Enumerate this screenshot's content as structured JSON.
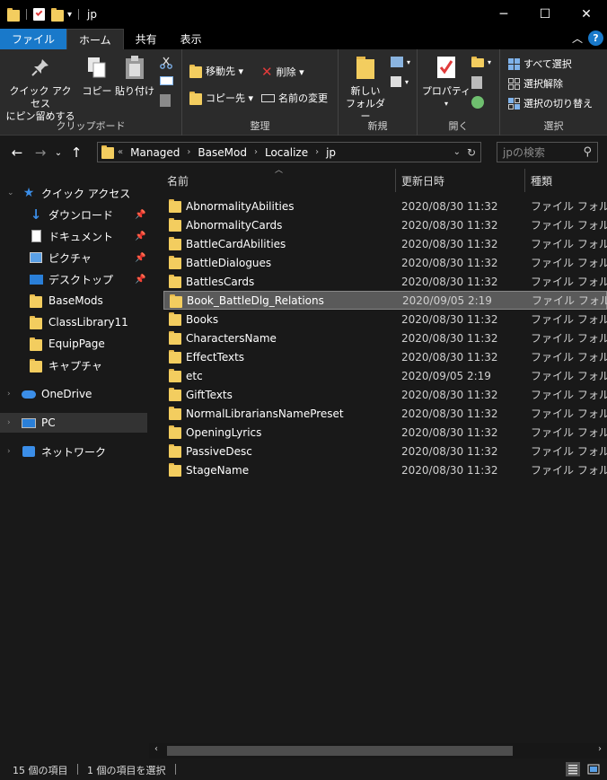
{
  "window": {
    "title": "jp",
    "quick_access_dropdown": "▾",
    "minimize": "─",
    "maximize": "☐",
    "close": "✕"
  },
  "ribbon_tabs": [
    {
      "label": "ファイル"
    },
    {
      "label": "ホーム"
    },
    {
      "label": "共有"
    },
    {
      "label": "表示"
    }
  ],
  "ribbon": {
    "clipboard": {
      "group_label": "クリップボード",
      "pin_quick_access_line1": "クイック アクセス",
      "pin_quick_access_line2": "にピン留めする",
      "copy": "コピー",
      "paste": "貼り付け"
    },
    "organize": {
      "group_label": "整理",
      "move_to": "移動先 ▾",
      "copy_to": "コピー先 ▾",
      "delete": "削除 ▾",
      "rename": "名前の変更"
    },
    "new": {
      "group_label": "新規",
      "new_folder_line1": "新しい",
      "new_folder_line2": "フォルダー"
    },
    "open": {
      "group_label": "開く",
      "properties": "プロパティ"
    },
    "select": {
      "group_label": "選択",
      "select_all": "すべて選択",
      "select_none": "選択解除",
      "invert_selection": "選択の切り替え"
    }
  },
  "address": {
    "overflow": "«",
    "crumbs": [
      "Managed",
      "BaseMod",
      "Localize",
      "jp"
    ],
    "search_placeholder": "jpの検索"
  },
  "navpane": {
    "quick_access": "クイック アクセス",
    "items": [
      {
        "label": "ダウンロード"
      },
      {
        "label": "ドキュメント"
      },
      {
        "label": "ピクチャ"
      },
      {
        "label": "デスクトップ"
      },
      {
        "label": "BaseMods"
      },
      {
        "label": "ClassLibrary11"
      },
      {
        "label": "EquipPage"
      },
      {
        "label": "キャプチャ"
      }
    ],
    "onedrive": "OneDrive",
    "pc": "PC",
    "network": "ネットワーク"
  },
  "columns": {
    "name": "名前",
    "date": "更新日時",
    "type": "種類"
  },
  "files": [
    {
      "name": "AbnormalityAbilities",
      "date": "2020/08/30 11:32",
      "type": "ファイル フォルダー"
    },
    {
      "name": "AbnormalityCards",
      "date": "2020/08/30 11:32",
      "type": "ファイル フォルダー"
    },
    {
      "name": "BattleCardAbilities",
      "date": "2020/08/30 11:32",
      "type": "ファイル フォルダー"
    },
    {
      "name": "BattleDialogues",
      "date": "2020/08/30 11:32",
      "type": "ファイル フォルダー"
    },
    {
      "name": "BattlesCards",
      "date": "2020/08/30 11:32",
      "type": "ファイル フォルダー"
    },
    {
      "name": "Book_BattleDlg_Relations",
      "date": "2020/09/05 2:19",
      "type": "ファイル フォルダー"
    },
    {
      "name": "Books",
      "date": "2020/08/30 11:32",
      "type": "ファイル フォルダー"
    },
    {
      "name": "CharactersName",
      "date": "2020/08/30 11:32",
      "type": "ファイル フォルダー"
    },
    {
      "name": "EffectTexts",
      "date": "2020/08/30 11:32",
      "type": "ファイル フォルダー"
    },
    {
      "name": "etc",
      "date": "2020/09/05 2:19",
      "type": "ファイル フォルダー"
    },
    {
      "name": "GiftTexts",
      "date": "2020/08/30 11:32",
      "type": "ファイル フォルダー"
    },
    {
      "name": "NormalLibrariansNamePreset",
      "date": "2020/08/30 11:32",
      "type": "ファイル フォルダー"
    },
    {
      "name": "OpeningLyrics",
      "date": "2020/08/30 11:32",
      "type": "ファイル フォルダー"
    },
    {
      "name": "PassiveDesc",
      "date": "2020/08/30 11:32",
      "type": "ファイル フォルダー"
    },
    {
      "name": "StageName",
      "date": "2020/08/30 11:32",
      "type": "ファイル フォルダー"
    }
  ],
  "status": {
    "item_count": "15 個の項目",
    "selected_count": "1 個の項目を選択"
  },
  "colors": {
    "accent": "#1979ca",
    "folder": "#f3cd5f",
    "background": "#191919",
    "ribbon": "#2b2b2b"
  }
}
